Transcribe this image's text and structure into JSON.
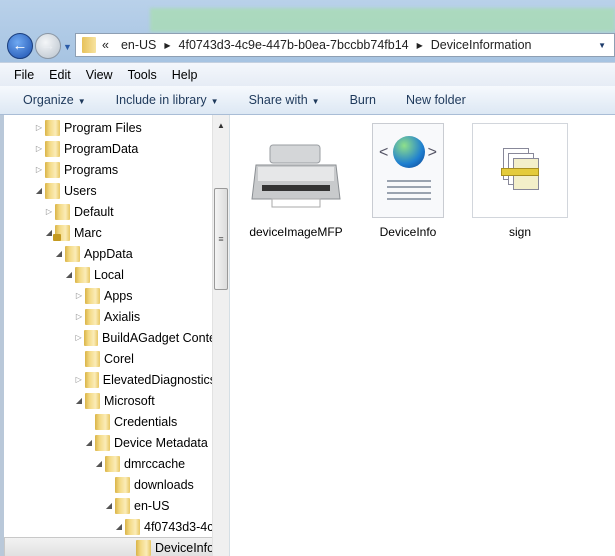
{
  "address_bar": {
    "overflow": "«",
    "segments": [
      "en-US",
      "4f0743d3-4c9e-447b-b0ea-7bccbb74fb14",
      "DeviceInformation"
    ]
  },
  "menu": [
    "File",
    "Edit",
    "View",
    "Tools",
    "Help"
  ],
  "commands": {
    "organize": "Organize",
    "include": "Include in library",
    "share": "Share with",
    "burn": "Burn",
    "new_folder": "New folder"
  },
  "tree": [
    {
      "label": "Program Files",
      "level": 0,
      "state": "collapsed"
    },
    {
      "label": "ProgramData",
      "level": 0,
      "state": "collapsed"
    },
    {
      "label": "Programs",
      "level": 0,
      "state": "collapsed"
    },
    {
      "label": "Users",
      "level": 0,
      "state": "expanded"
    },
    {
      "label": "Default",
      "level": 1,
      "state": "collapsed"
    },
    {
      "label": "Marc",
      "level": 1,
      "state": "expanded",
      "locked": true
    },
    {
      "label": "AppData",
      "level": 2,
      "state": "expanded"
    },
    {
      "label": "Local",
      "level": 3,
      "state": "expanded"
    },
    {
      "label": "Apps",
      "level": 4,
      "state": "collapsed"
    },
    {
      "label": "Axialis",
      "level": 4,
      "state": "collapsed"
    },
    {
      "label": "BuildAGadget Conte",
      "level": 4,
      "state": "collapsed"
    },
    {
      "label": "Corel",
      "level": 4,
      "state": "none"
    },
    {
      "label": "ElevatedDiagnostics",
      "level": 4,
      "state": "collapsed"
    },
    {
      "label": "Microsoft",
      "level": 4,
      "state": "expanded"
    },
    {
      "label": "Credentials",
      "level": 5,
      "state": "none"
    },
    {
      "label": "Device Metadata",
      "level": 5,
      "state": "expanded"
    },
    {
      "label": "dmrccache",
      "level": 6,
      "state": "expanded"
    },
    {
      "label": "downloads",
      "level": 7,
      "state": "none"
    },
    {
      "label": "en-US",
      "level": 7,
      "state": "expanded"
    },
    {
      "label": "4f0743d3-4c",
      "level": 8,
      "state": "expanded"
    },
    {
      "label": "DeviceInfo",
      "level": 9,
      "state": "none",
      "selected": true
    }
  ],
  "files": [
    {
      "name": "deviceImageMFP",
      "icon": "printer-icon"
    },
    {
      "name": "DeviceInfo",
      "icon": "xml-document-icon"
    },
    {
      "name": "sign",
      "icon": "certificate-document-icon"
    }
  ]
}
